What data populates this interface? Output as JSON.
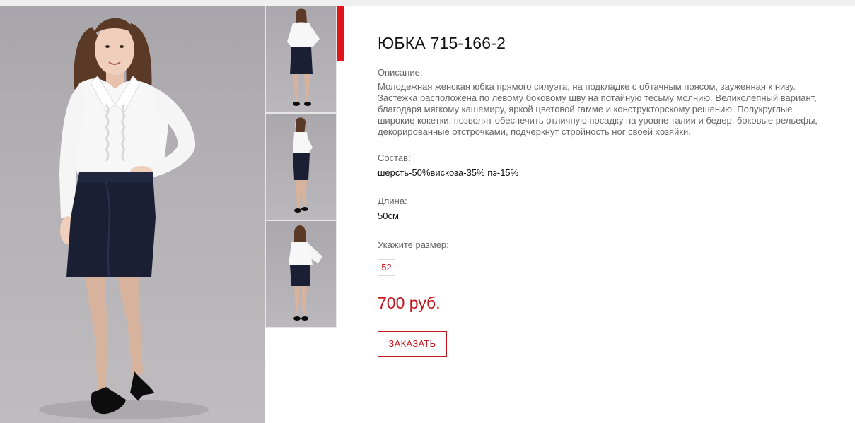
{
  "product": {
    "title": "ЮБКА 715-166-2",
    "description_label": "Описание:",
    "description": "Молодежная женская юбка прямого силуэта, на подкладке с обтачным поясом, зауженная к низу. Застежка расположена по левому боковому шву на потайную тесьму молнию. Великолепный вариант, благодаря мягкому кашемиру, яркой цветовой гамме и конструкторскому решению. Полукруглые широкие кокетки, позволят обеспечить отличную посадку на уровне талии и бедер, боковые рельефы, декорированные отстрочками, подчеркнут стройность ног своей хозяйки.",
    "composition_label": "Состав:",
    "composition": "шерсть-50%вискоза-35% пэ-15%",
    "length_label": "Длина:",
    "length": "50см",
    "size_label": "Укажите размер:",
    "sizes": [
      "52"
    ],
    "price": "700 руб.",
    "order_label": "ЗАКАЗАТЬ"
  },
  "colors": {
    "accent": "#c8161d",
    "accent_bar": "#e1141b",
    "skirt": "#1a1f33",
    "blouse": "#f7f7f7",
    "backdrop": "#b3b1b5"
  }
}
